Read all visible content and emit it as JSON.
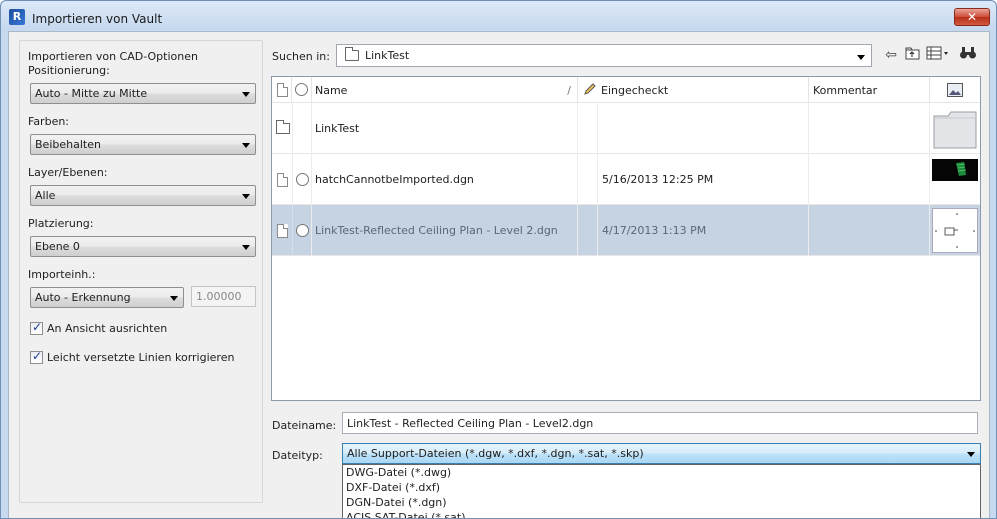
{
  "window": {
    "title": "Importieren von Vault",
    "app_icon_letter": "R",
    "close_symbol": "✕"
  },
  "options": {
    "group_title": "Importieren von CAD-Optionen",
    "positioning_label": "Positionierung:",
    "positioning_value": "Auto - Mitte zu Mitte",
    "colors_label": "Farben:",
    "colors_value": "Beibehalten",
    "layers_label": "Layer/Ebenen:",
    "layers_value": "Alle",
    "placement_label": "Platzierung:",
    "placement_value": "Ebene 0",
    "units_label": "Importeinh.:",
    "units_value": "Auto - Erkennung",
    "scale_value": "1.00000",
    "orient_label": "An Ansicht ausrichten",
    "orient_checked": true,
    "correct_label": "Leicht versetzte Linien korrigieren",
    "correct_checked": true
  },
  "search": {
    "label": "Suchen in:",
    "location": "LinkTest"
  },
  "columns": {
    "name": "Name",
    "checked_in": "Eingecheckt",
    "comment": "Kommentar",
    "sort_indicator": "/"
  },
  "files": [
    {
      "name": "LinkTest",
      "checked_in": "",
      "comment": "",
      "type": "folder"
    },
    {
      "name": "hatchCannotbeImported.dgn",
      "checked_in": "5/16/2013 12:25 PM",
      "comment": "",
      "type": "file"
    },
    {
      "name": "LinkTest-Reflected Ceiling Plan - Level 2.dgn",
      "checked_in": "4/17/2013 1:13 PM",
      "comment": "",
      "type": "file",
      "selected": true
    }
  ],
  "filename": {
    "label": "Dateiname:",
    "value": "LinkTest - Reflected Ceiling Plan - Level2.dgn"
  },
  "filetype": {
    "label": "Dateityp:",
    "value": "Alle Support-Dateien (*.dgw, *.dxf, *.dgn, *.sat, *.skp)",
    "options": [
      "DWG-Datei (*.dwg)",
      "DXF-Datei (*.dxf)",
      "DGN-Datei (*.dgn)",
      "ACIS SAT-Datei (*.sat)"
    ]
  },
  "toolbar_icons": [
    "back-icon",
    "up-folder-icon",
    "views-icon",
    "find-icon"
  ],
  "colors": {
    "selected_row": "#c5d3e2",
    "close_button": "#c94631"
  }
}
